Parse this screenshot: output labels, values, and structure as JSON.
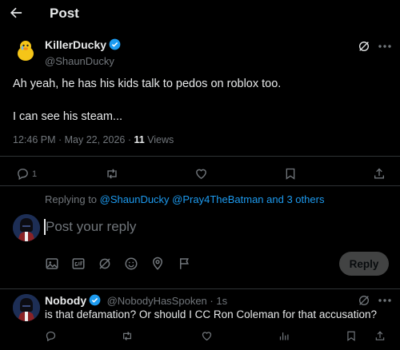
{
  "header": {
    "title": "Post"
  },
  "tweet": {
    "author_name": "KillerDucky",
    "author_handle": "@ShaunDucky",
    "text_line1": "Ah yeah, he has his kids talk to pedos on roblox too.",
    "text_line2": "I can see his steam...",
    "timestamp": "12:46 PM · May 22, 2026 · ",
    "views_count": "11",
    "views_label": " Views",
    "reply_count": "1"
  },
  "composer": {
    "replying_prefix": "Replying to ",
    "replying_users": "@ShaunDucky @Pray4TheBatman",
    "replying_and": " and ",
    "replying_others": "3 others",
    "placeholder": "Post your reply",
    "reply_button": "Reply"
  },
  "reply": {
    "author_name": "Nobody",
    "author_handle": "@NobodyHasSpoken",
    "time": " · 1s",
    "text": "is that defamation? Or should I CC Ron Coleman for that accusation?"
  },
  "icons": {
    "back": "arrow-left-icon",
    "grok": "grok-icon",
    "more": "more-icon",
    "reply": "reply-icon",
    "repost": "repost-icon",
    "like": "like-icon",
    "bookmark": "bookmark-icon",
    "share": "share-icon",
    "views": "views-icon"
  },
  "colors": {
    "accent": "#1d9bf0",
    "muted": "#71767b",
    "text": "#e7e9ea",
    "background": "#000000"
  }
}
